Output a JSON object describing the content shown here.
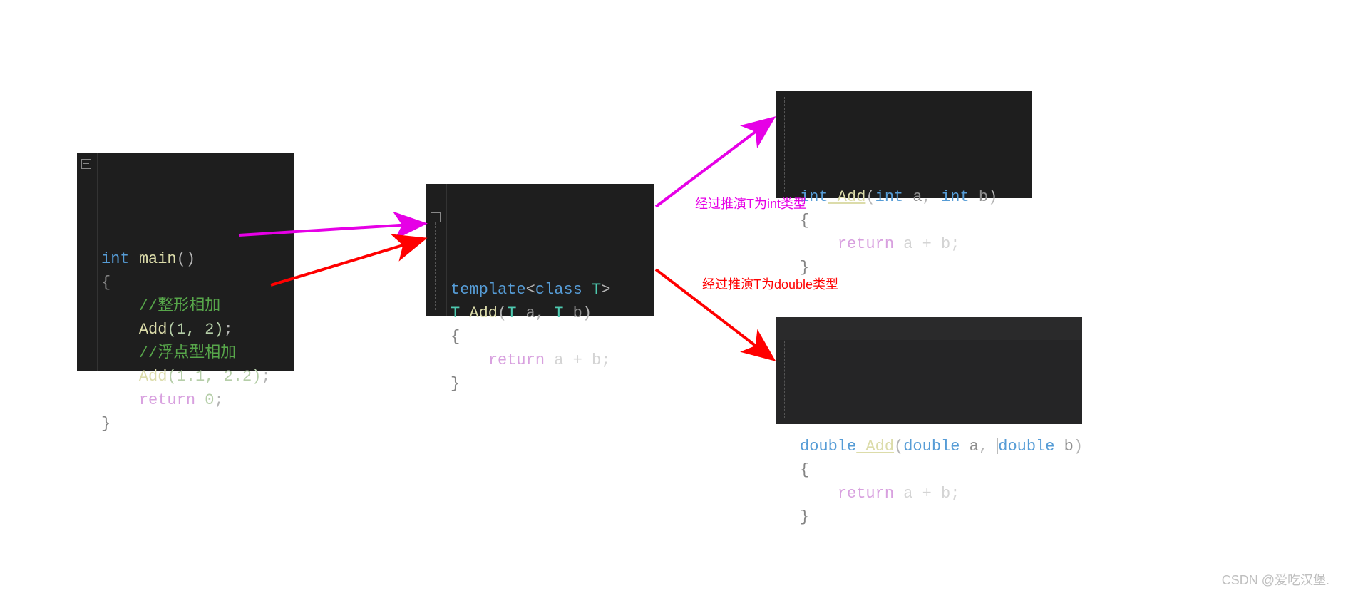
{
  "boxes": {
    "main": {
      "lines": {
        "sig_int": "int",
        "sig_func": "main",
        "sig_par": "()",
        "open": "{",
        "comment1": "//整形相加",
        "call1_fn": "Add",
        "call1_args": "(1, 2)",
        "call1_end": ";",
        "comment2": "//浮点型相加",
        "call2_fn": "Add",
        "call2_args": "(1.1, 2.2)",
        "call2_end": ";",
        "retkw": "return",
        "retnum": " 0",
        "retend": ";",
        "close": "}"
      }
    },
    "template": {
      "kw": "template",
      "open_angle": "<",
      "classkw": "class",
      "T": " T",
      "close_angle": ">",
      "signT1": "T",
      "fn": " Add",
      "sig_open": "(",
      "sigT2": "T",
      "a": " a",
      "comma": ", ",
      "sigT3": "T",
      "b": " b",
      "sig_close": ")",
      "open_brace": "{",
      "retkw": "return",
      "expr": " a + b;",
      "close_brace": "}"
    },
    "int_spec": {
      "intkw1": "int",
      "fn": " Add",
      "open": "(",
      "intkw2": "int",
      "a": " a",
      "comma": ", ",
      "intkw3": "int",
      "b": " b",
      "close": ")",
      "open_brace": "{",
      "retkw": "return",
      "expr": " a + b;",
      "close_brace": "}"
    },
    "dbl_spec": {
      "dblkw1": "double",
      "fn": " Add",
      "open": "(",
      "dblkw2": "double",
      "a": " a",
      "comma": ", ",
      "dblkw3": "double",
      "b": " b",
      "close": ")",
      "open_brace": "{",
      "retkw": "return",
      "expr": " a + b;",
      "close_brace": "}"
    }
  },
  "labels": {
    "intLabel": "经过推演T为int类型",
    "dblLabel": "经过推演T为double类型"
  },
  "watermark": "CSDN @爱吃汉堡."
}
